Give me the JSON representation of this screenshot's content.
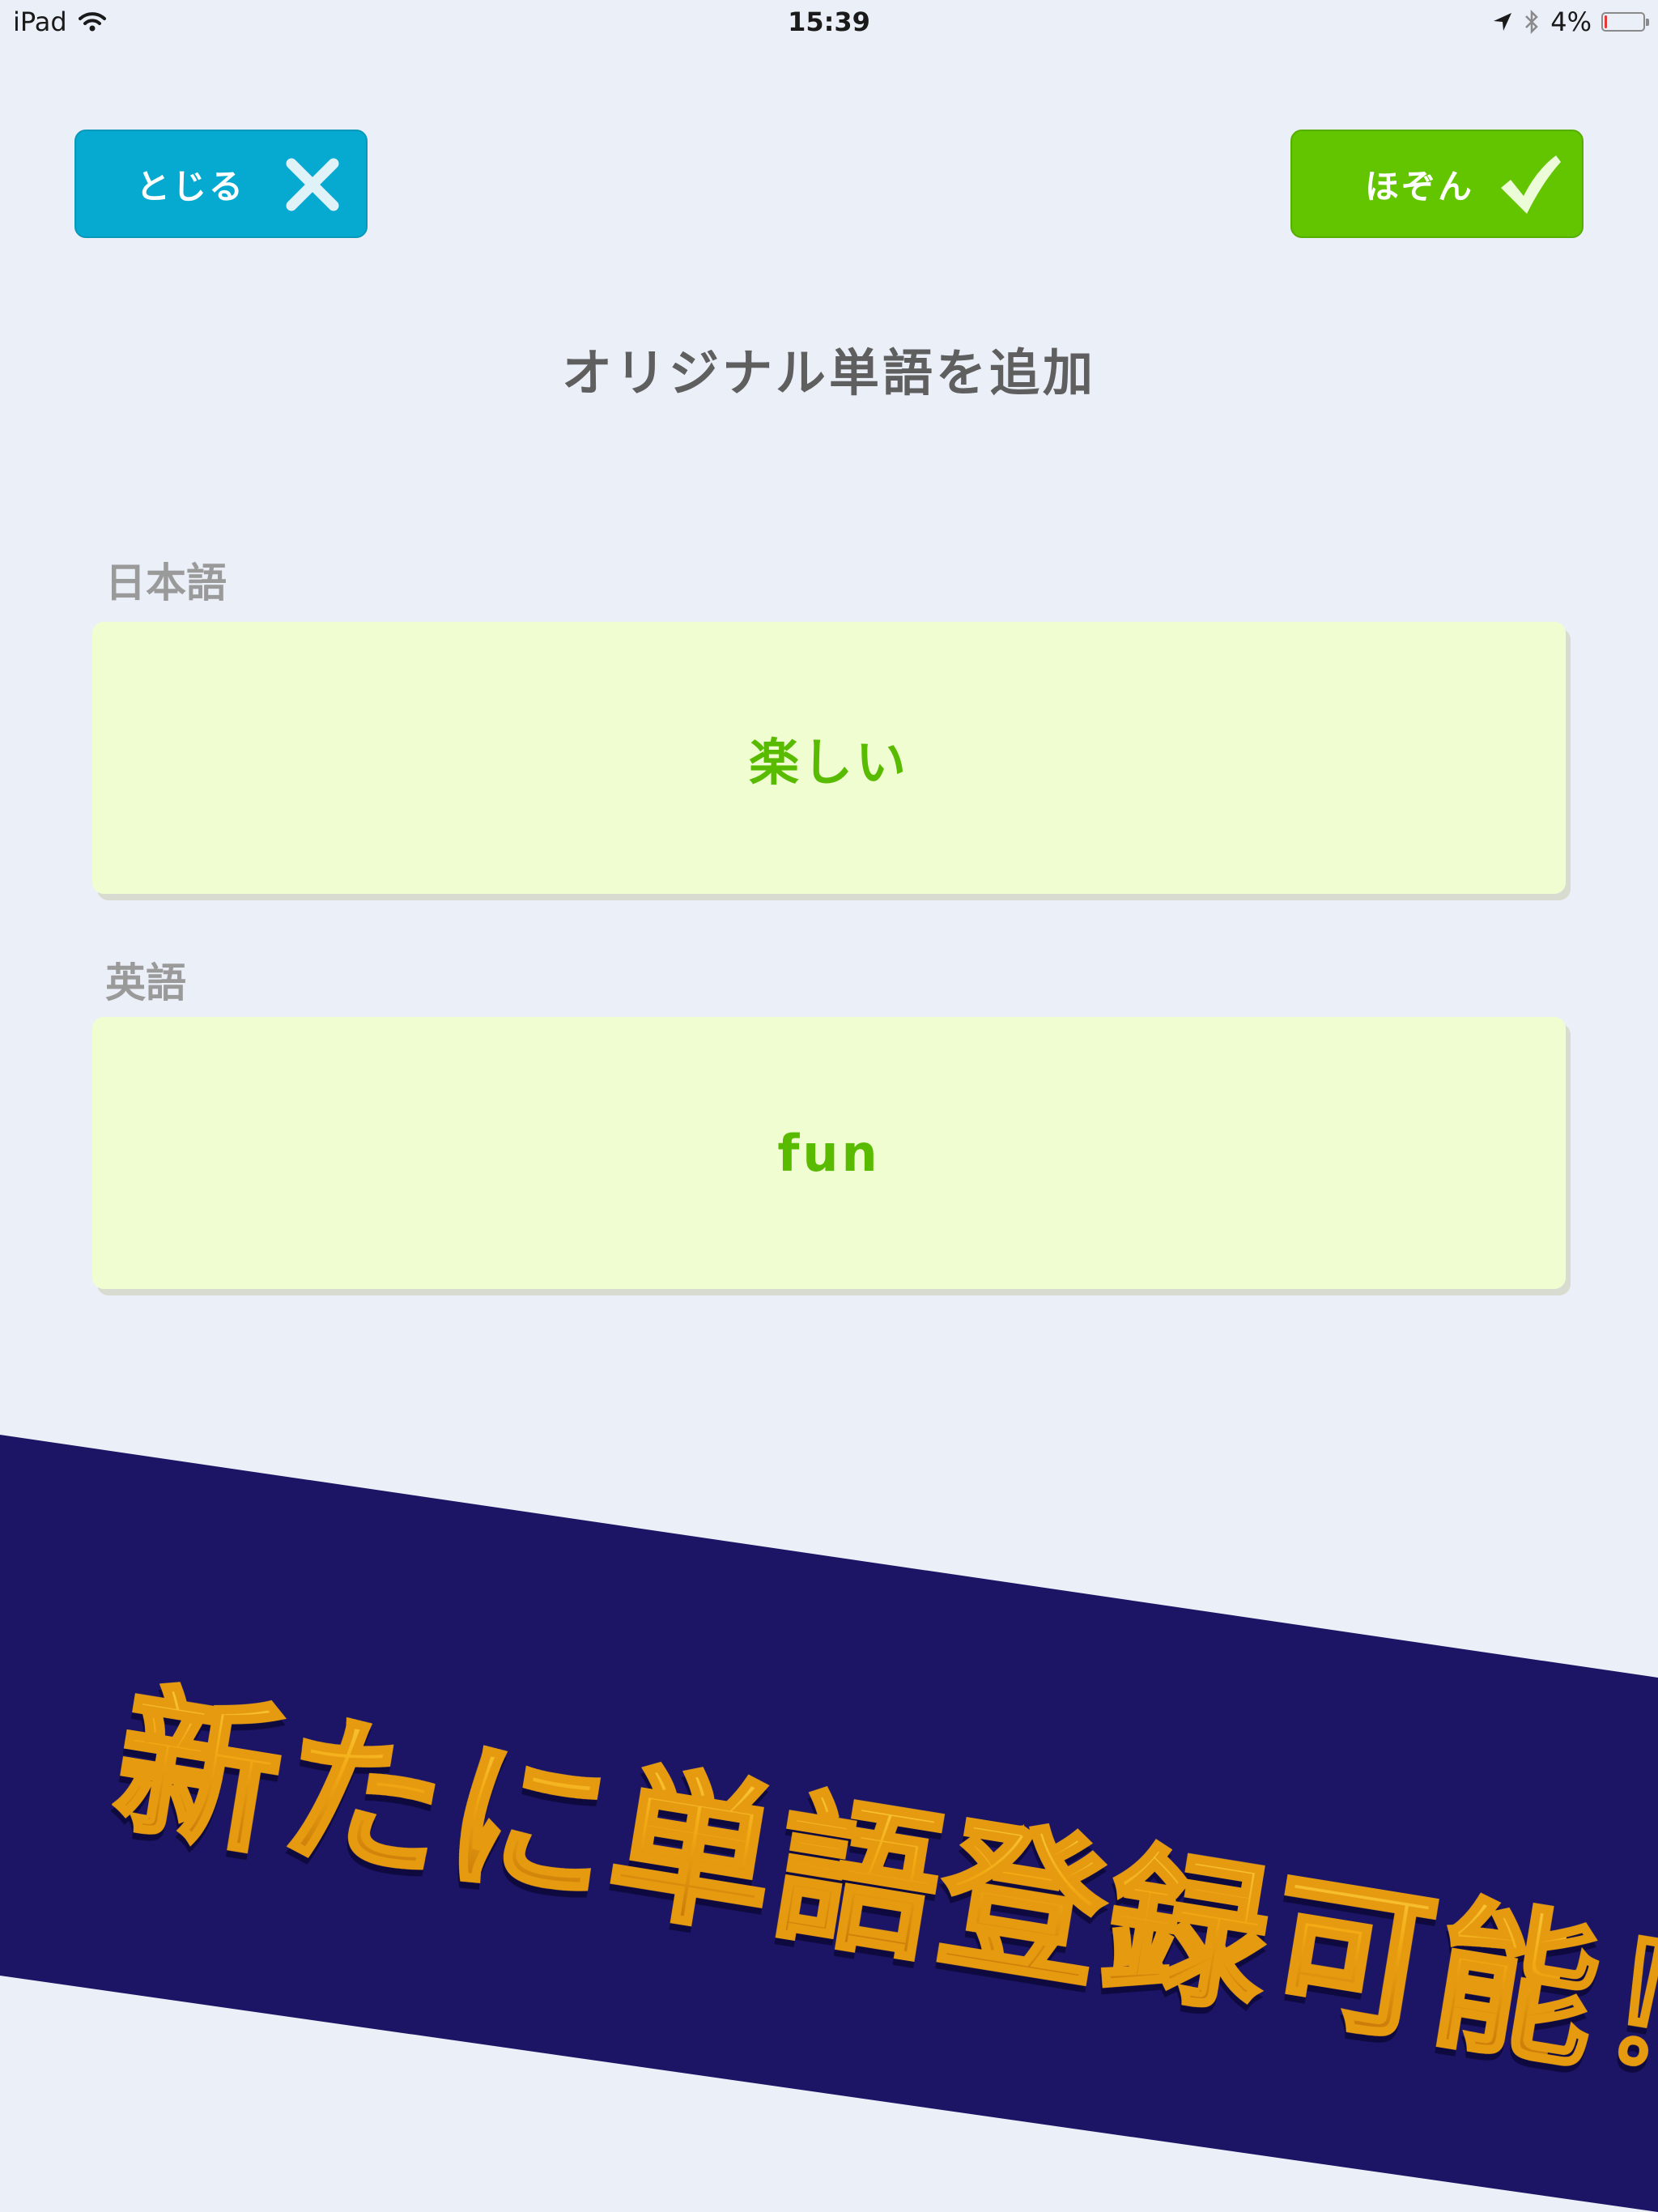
{
  "status_bar": {
    "device": "iPad",
    "time": "15:39",
    "battery": "4%",
    "battery_level": 0.04
  },
  "buttons": {
    "close_label": "とじる",
    "save_label": "ほぞん"
  },
  "title": "オリジナル単語を追加",
  "fields": {
    "japanese": {
      "label": "日本語",
      "value": "楽しい"
    },
    "english": {
      "label": "英語",
      "value": "fun"
    }
  },
  "promo": {
    "text": "新たに単語登録可能！"
  },
  "colors": {
    "background": "#ebeff8",
    "close_button": "#06a9cf",
    "save_button": "#63c500",
    "field_bg": "#f0fdd1",
    "field_text": "#59bb00",
    "banner": "#1c1566",
    "promo_text": "#f2ab14"
  },
  "icons": {
    "close": "close-x-icon",
    "save": "checkmark-icon",
    "wifi": "wifi-icon",
    "location": "location-arrow-icon",
    "bluetooth": "bluetooth-icon",
    "battery": "battery-icon"
  }
}
